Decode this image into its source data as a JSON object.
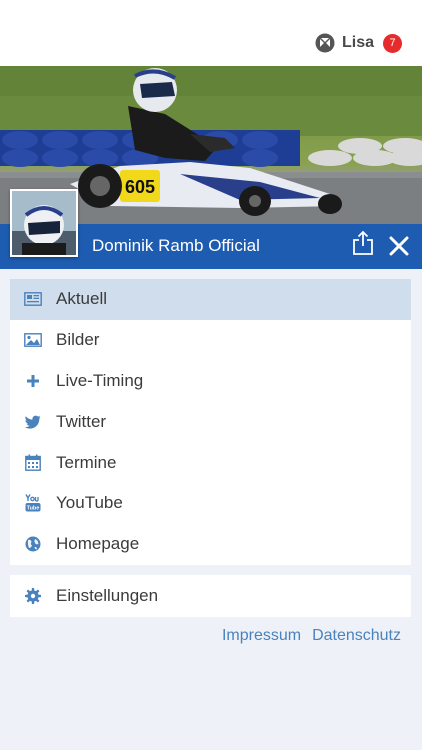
{
  "header": {
    "user_name": "Lisa",
    "notification_count": "7"
  },
  "profile": {
    "title": "Dominik Ramb Official",
    "kart_number": "605"
  },
  "menu": {
    "items": [
      {
        "label": "Aktuell",
        "icon": "newspaper-icon",
        "active": true
      },
      {
        "label": "Bilder",
        "icon": "image-icon",
        "active": false
      },
      {
        "label": "Live-Timing",
        "icon": "plus-icon",
        "active": false
      },
      {
        "label": "Twitter",
        "icon": "twitter-icon",
        "active": false
      },
      {
        "label": "Termine",
        "icon": "calendar-icon",
        "active": false
      },
      {
        "label": "YouTube",
        "icon": "youtube-icon",
        "active": false
      },
      {
        "label": "Homepage",
        "icon": "globe-icon",
        "active": false
      }
    ]
  },
  "settings": {
    "label": "Einstellungen",
    "icon": "gear-icon"
  },
  "footer": {
    "impressum": "Impressum",
    "datenschutz": "Datenschutz"
  },
  "colors": {
    "brand_blue": "#1d5cb0",
    "icon_blue": "#4a82bd",
    "active_row": "#cfddec",
    "badge_red": "#e52b2b"
  }
}
